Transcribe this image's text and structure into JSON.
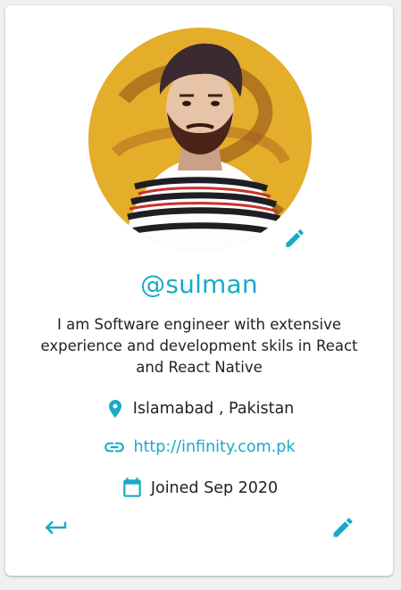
{
  "theme": {
    "accent": "#18aac8",
    "text": "#222222",
    "avatar_bg": "#e4ad2a"
  },
  "profile": {
    "username": "@sulman",
    "bio": "I am Software engineer with extensive experience and development skils in React and React Native",
    "location": "Islamabad , Pakistan",
    "website": "http://infinity.com.pk",
    "joined": "Joined Sep 2020"
  },
  "icons": {
    "avatar_edit": "pencil-icon",
    "location": "map-pin-icon",
    "website": "link-icon",
    "joined": "calendar-icon",
    "back": "keyboard-return-icon",
    "edit": "pencil-icon"
  }
}
